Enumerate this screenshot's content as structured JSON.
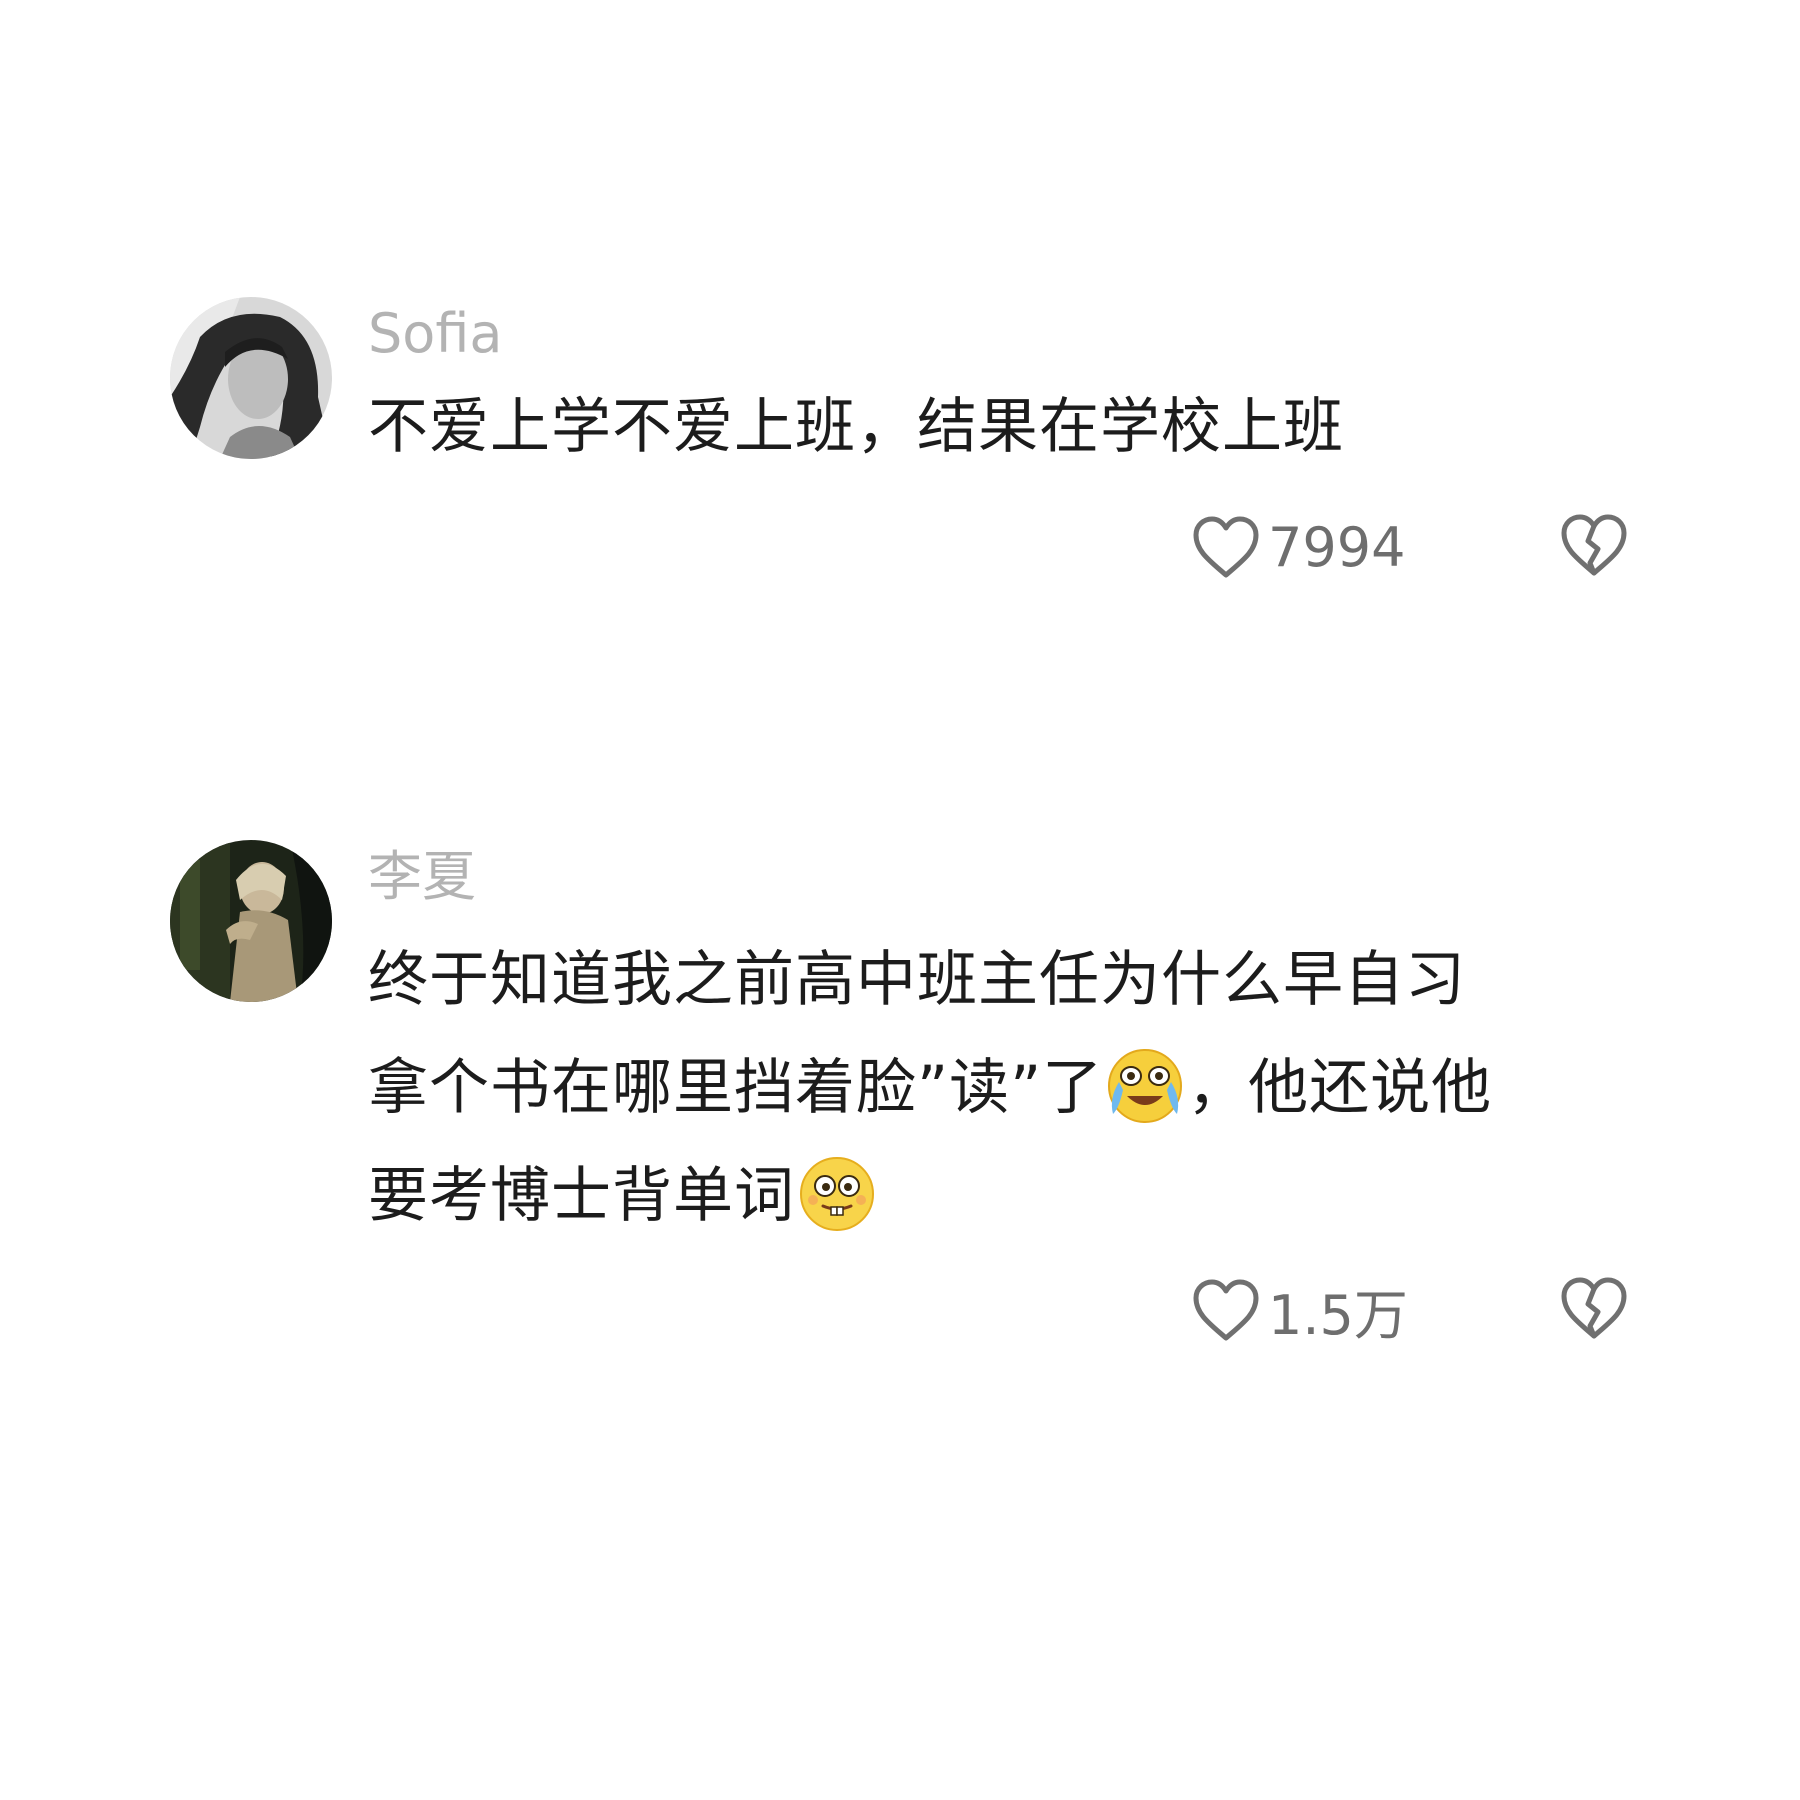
{
  "comments": [
    {
      "username": "Sofia",
      "text": "不爱上学不爱上班，结果在学校上班",
      "likes": "7994",
      "avatar_icon": "user-avatar"
    },
    {
      "username": "李夏",
      "text_line1": "终于知道我之前高中班主任为什么早自习",
      "text_line2_a": "拿个书在哪里挡着脸”读”了",
      "text_line2_b": "，他还说他",
      "text_line3": "要考博士背单词",
      "emoji_1": "crying-laughing-emoji",
      "emoji_2": "buck-teeth-emoji",
      "likes": "1.5万",
      "avatar_icon": "user-avatar"
    }
  ],
  "icons": {
    "like": "heart-outline-icon",
    "dislike": "broken-heart-icon"
  },
  "colors": {
    "background": "#ffffff",
    "username": "#b3b3b3",
    "text": "#1c1c1c",
    "count": "#6e6e6e",
    "icon": "#707070"
  }
}
